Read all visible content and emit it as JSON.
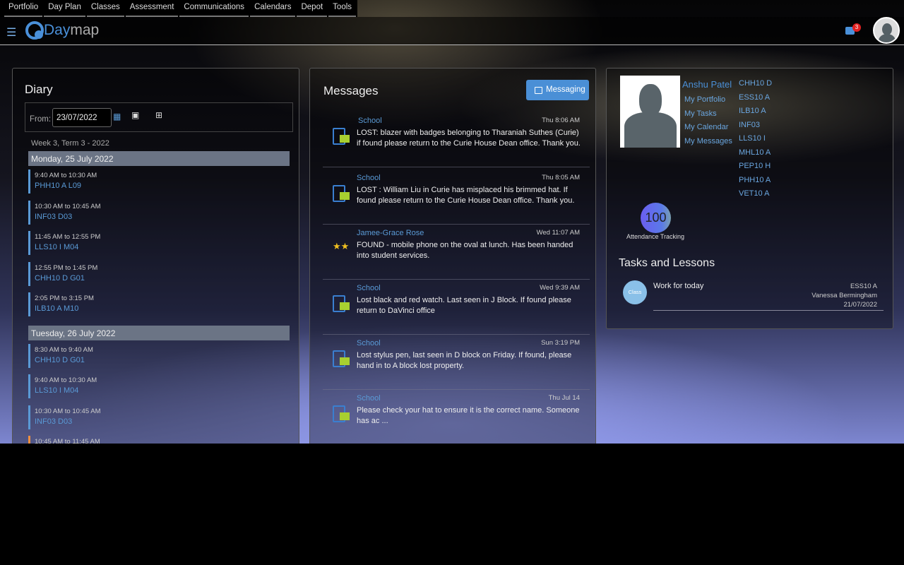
{
  "nav": [
    "Portfolio",
    "Day Plan",
    "Classes",
    "Assessment",
    "Communications",
    "Calendars",
    "Depot",
    "Tools"
  ],
  "header": {
    "logo_a": "Day",
    "logo_b": "map",
    "notifications": "3"
  },
  "diary": {
    "title": "Diary",
    "from_label": "From:",
    "from_value": "23/07/2022",
    "week": "Week 3, Term 3 - 2022",
    "days": [
      {
        "label": "Monday, 25 July 2022",
        "events": [
          {
            "time": "9:40 AM to 10:30 AM",
            "class": "PHH10 A L09"
          },
          {
            "time": "10:30 AM to 10:45 AM",
            "class": "INF03 D03"
          },
          {
            "time": "11:45 AM to 12:55 PM",
            "class": "LLS10 I M04"
          },
          {
            "time": "12:55 PM to 1:45 PM",
            "class": "CHH10 D G01"
          },
          {
            "time": "2:05 PM to 3:15 PM",
            "class": "ILB10 A M10"
          }
        ]
      },
      {
        "label": "Tuesday, 26 July 2022",
        "events": [
          {
            "time": "8:30 AM to 9:40 AM",
            "class": "CHH10 D G01"
          },
          {
            "time": "9:40 AM to 10:30 AM",
            "class": "LLS10 I M04"
          },
          {
            "time": "10:30 AM to 10:45 AM",
            "class": "INF03 D03"
          },
          {
            "time": "10:45 AM to 11:45 AM",
            "class": ""
          }
        ]
      }
    ]
  },
  "messages": {
    "title": "Messages",
    "button": "Messaging",
    "items": [
      {
        "sender": "School",
        "date": "Thu 8:06 AM",
        "body": "LOST: blazer with badges belonging to Tharaniah Suthes (Curie) if found please return to the Curie House Dean office. Thank you.",
        "icon": "message-doc-icon"
      },
      {
        "sender": "School",
        "date": "Thu 8:05 AM",
        "body": "LOST : William Liu in Curie has misplaced his brimmed hat. If found please return to the Curie House Dean office. Thank you.",
        "icon": "message-doc-icon"
      },
      {
        "sender": "Jamee-Grace Rose",
        "date": "Wed 11:07 AM",
        "body": "FOUND - mobile phone on the oval at lunch. Has been handed into student services.",
        "icon": "stars-icon"
      },
      {
        "sender": "School",
        "date": "Wed 9:39 AM",
        "body": "Lost black and red watch. Last seen in J Block. If found please return to DaVinci office",
        "icon": "message-doc-icon"
      },
      {
        "sender": "School",
        "date": "Sun 3:19 PM",
        "body": "Lost stylus pen, last seen in D block on Friday. If found, please hand in to A block lost property.",
        "icon": "message-doc-icon"
      },
      {
        "sender": "School",
        "date": "Thu Jul 14",
        "body": "Please check your hat to ensure it is the correct name. Someone has ac ...",
        "icon": "message-doc-icon"
      }
    ]
  },
  "profile": {
    "name": "Anshu Patel",
    "links": [
      "My Portfolio",
      "My Tasks",
      "My Calendar",
      "My Messages"
    ],
    "classes": [
      "CHH10 D",
      "ESS10 A",
      "ILB10 A",
      "INF03",
      "LLS10 I",
      "MHL10 A",
      "PEP10 H",
      "PHH10 A",
      "VET10 A"
    ],
    "attendance": "100",
    "attendance_label": "Attendance Tracking"
  },
  "tasks": {
    "title": "Tasks and Lessons",
    "items": [
      {
        "badge": "Class",
        "title": "Work for today",
        "class": "ESS10 A",
        "teacher": "Vanessa Bermingham",
        "date": "21/07/2022"
      }
    ]
  }
}
